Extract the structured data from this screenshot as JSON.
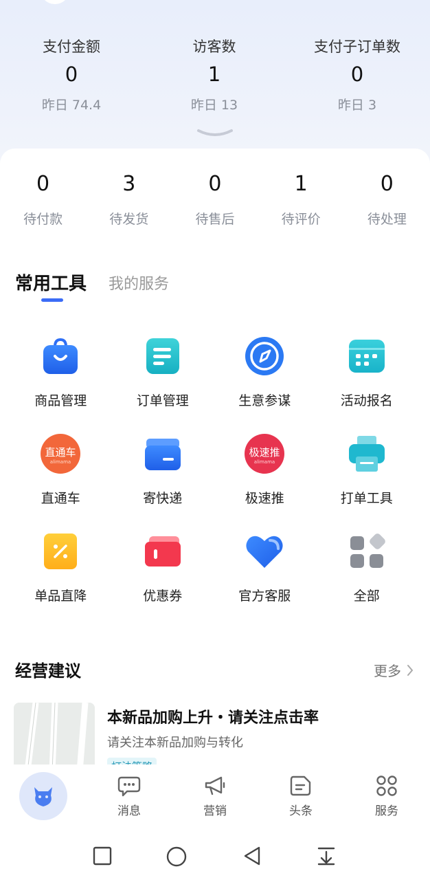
{
  "stats": [
    {
      "label": "支付金额",
      "value": "0",
      "yesterday": "昨日 74.4"
    },
    {
      "label": "访客数",
      "value": "1",
      "yesterday": "昨日 13"
    },
    {
      "label": "支付子订单数",
      "value": "0",
      "yesterday": "昨日 3"
    }
  ],
  "orders": [
    {
      "count": "0",
      "label": "待付款"
    },
    {
      "count": "3",
      "label": "待发货"
    },
    {
      "count": "0",
      "label": "待售后"
    },
    {
      "count": "1",
      "label": "待评价"
    },
    {
      "count": "0",
      "label": "待处理"
    }
  ],
  "tabs": {
    "active": "常用工具",
    "inactive": "我的服务"
  },
  "tools": [
    {
      "label": "商品管理",
      "icon": "bag-icon"
    },
    {
      "label": "订单管理",
      "icon": "order-list-icon"
    },
    {
      "label": "生意参谋",
      "icon": "compass-icon"
    },
    {
      "label": "活动报名",
      "icon": "calendar-icon"
    },
    {
      "label": "直通车",
      "icon": "ztc-logo-icon",
      "icon_text": "直通车",
      "icon_sub": "alimama"
    },
    {
      "label": "寄快递",
      "icon": "parcel-box-icon"
    },
    {
      "label": "极速推",
      "icon": "jst-logo-icon",
      "icon_text": "极速推",
      "icon_sub": "alimama"
    },
    {
      "label": "打单工具",
      "icon": "printer-icon"
    },
    {
      "label": "单品直降",
      "icon": "discount-ticket-icon"
    },
    {
      "label": "优惠券",
      "icon": "coupon-icon"
    },
    {
      "label": "官方客服",
      "icon": "heart-service-icon"
    },
    {
      "label": "全部",
      "icon": "all-grid-icon"
    }
  ],
  "suggestions": {
    "title": "经营建议",
    "more": "更多",
    "item": {
      "title": "本新品加购上升・请关注点击率",
      "subtitle": "请关注本新品加购与转化",
      "tag": "打法策略"
    }
  },
  "tabbar": [
    {
      "label": "",
      "icon": "home-cow-icon"
    },
    {
      "label": "消息",
      "icon": "message-icon"
    },
    {
      "label": "营销",
      "icon": "megaphone-icon"
    },
    {
      "label": "头条",
      "icon": "news-icon"
    },
    {
      "label": "服务",
      "icon": "service-grid-icon"
    }
  ],
  "colors": {
    "accent": "#3b6cf6",
    "tab_indicator": "#3b6cf6",
    "background_top": "#e8eefb"
  }
}
